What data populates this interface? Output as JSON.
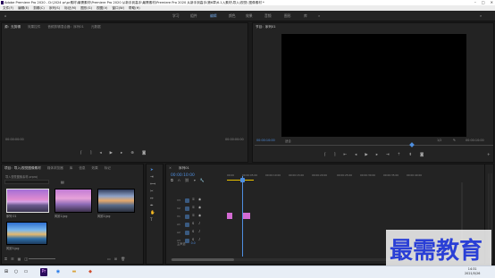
{
  "title_bar": {
    "text": "Adobe Premiere Pro 2020 - D:\\2024 pr\\pr素材\\最需素材\\Premiere Pro 2020 从新手到高手\\最需素材\\Premiere Pro 2020 从新手到高手\\第6章\\6.1入素材\\导入\\视觉\\ 图像素材 *"
  },
  "menu": [
    "文件(F)",
    "编辑(E)",
    "剪辑(C)",
    "序列(S)",
    "标记(M)",
    "图形(G)",
    "视图(V)",
    "窗口(W)",
    "帮助(H)"
  ],
  "workspaces": {
    "items": [
      "学习",
      "组件",
      "编辑",
      "颜色",
      "效果",
      "音频",
      "图形",
      "库"
    ],
    "active_index": 2
  },
  "source_panel": {
    "tabs": [
      "源：无剪辑",
      "效果控件",
      "音频剪辑混合器：序列01",
      "元数据"
    ],
    "timecode_in": "00:00:00:00",
    "timecode_out": "00:00:00:00"
  },
  "program_panel": {
    "tab": "节目：序列01",
    "timecode": "00:00:10:00",
    "fit": "适合",
    "resolution": "1/2",
    "duration": "00:00:10:00"
  },
  "project_panel": {
    "tabs": [
      "项目：导入/视觉图像素材",
      "媒体浏览器",
      "库",
      "信息",
      "效果",
      "标记"
    ],
    "project_file": "导入视觉图像素材.prproj",
    "items": [
      {
        "name": "序列 01",
        "duration": ""
      },
      {
        "name": "风景1.jpg",
        "duration": ""
      },
      {
        "name": "风景2.jpg",
        "duration": ""
      },
      {
        "name": "风景3.jpg",
        "duration": ""
      }
    ]
  },
  "timeline_panel": {
    "tab": "序列01",
    "timecode": "00:00:10:00",
    "ruler_labels": [
      "00:00",
      "00:00:05:00",
      "00:00:10:00",
      "00:00:15:00",
      "00:00:20:00",
      "00:00:25:00",
      "00:00:30:00",
      "00:00:35:00",
      "00:00:40:00"
    ],
    "tracks": [
      "V3",
      "V2",
      "V1",
      "A1",
      "A2",
      "A3"
    ],
    "master": "主声道",
    "master_value": "0.0"
  },
  "watermark": "最需教育",
  "taskbar": {
    "time": "14:31",
    "date": "2021/5/26"
  },
  "colors": {
    "accent": "#4f8fe0",
    "clip": "#d36bd3",
    "watermark": "#2a3fd6"
  }
}
